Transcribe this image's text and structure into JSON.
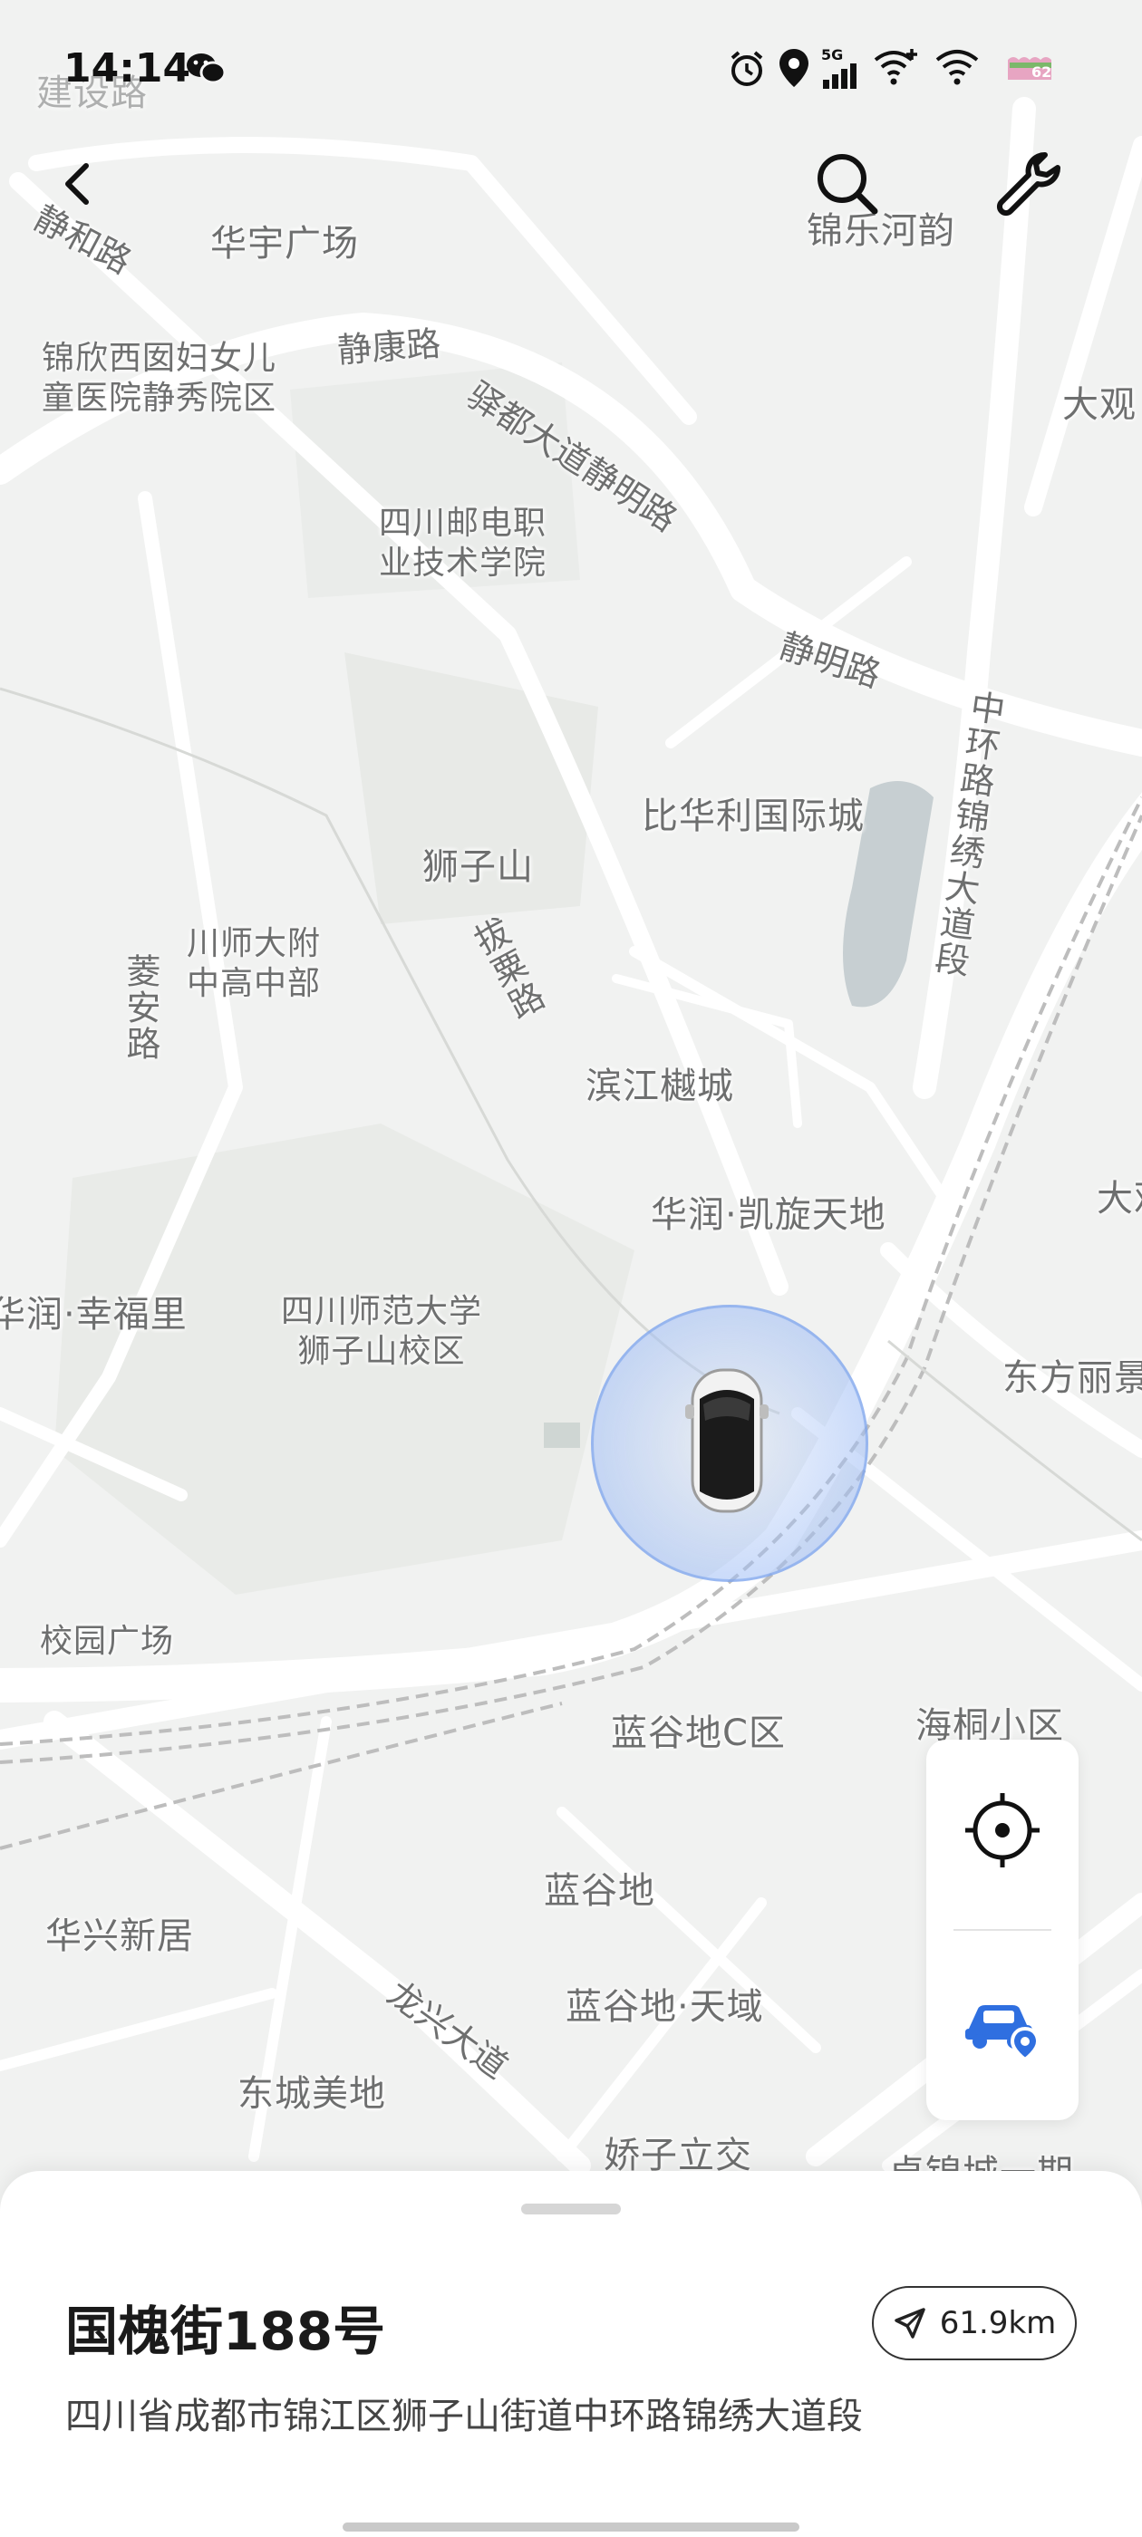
{
  "status_bar": {
    "time": "14:14",
    "icons": [
      "wechat-icon",
      "alarm-icon",
      "location-pin-icon",
      "5g-signal-icon",
      "wifi-plus-icon",
      "wifi-icon",
      "battery-icon"
    ],
    "network": "5G"
  },
  "toolbar": {
    "icons": [
      "back-arrow-icon",
      "search-icon",
      "wrench-icon"
    ]
  },
  "map": {
    "labels": {
      "top_left_partial": "建设路",
      "huayu": "华宇广场",
      "jingle_heyun": "锦乐河韵",
      "hospital": "锦欣西囡妇女儿\n童医院静秀院区",
      "sichuan_post": "四川邮电职\n业技术学院",
      "dagun": "大观",
      "bihuali": "比华利国际城",
      "shizishan": "狮子山",
      "chuanshi_fz": "川师大附\n中高中部",
      "binjiang": "滨江樾城",
      "huarun_kaixuan": "华润·凯旋天地",
      "huarun_xingfu": "华润·幸福里",
      "sicnu": "四川师范大学\n狮子山校区",
      "dongfang": "东方丽景",
      "daguan2": "大观",
      "xiaoyuan": "校园广场",
      "langu_c": "蓝谷地C区",
      "haitong": "海桐小区",
      "langu": "蓝谷地",
      "huaxing": "华兴新居",
      "langu_tianyu": "蓝谷地·天域",
      "dongcheng": "东城美地",
      "jiaozi": "娇子立交",
      "dongjin": "卓锦城一期"
    },
    "roads": {
      "jinghe": "静和路",
      "jingkang": "静康路",
      "yidu": "驿都大道静明路",
      "jingming": "静明路",
      "zhonghuan": "中环路锦绣大道段",
      "lingan": "菱安路",
      "babao": "拔粟路",
      "longxing": "龙兴大道"
    },
    "colors": {
      "background": "#f1f2f1",
      "road": "#ffffff",
      "green": "#e6e8e5",
      "water": "#c5cdd0",
      "rail": "#b7b7b7"
    }
  },
  "vehicle_marker": {
    "icon": "car-icon",
    "halo_color": "#9ab6ee"
  },
  "controls": {
    "locate_icon": "crosshair-icon",
    "car_location_icon": "car-location-icon",
    "accent": "#2f6fe0"
  },
  "sheet": {
    "place_name": "国槐街188号",
    "address": "四川省成都市锦江区狮子山街道中环路锦绣大道段",
    "distance": "61.9km",
    "distance_icon": "navigate-arrow-icon"
  }
}
